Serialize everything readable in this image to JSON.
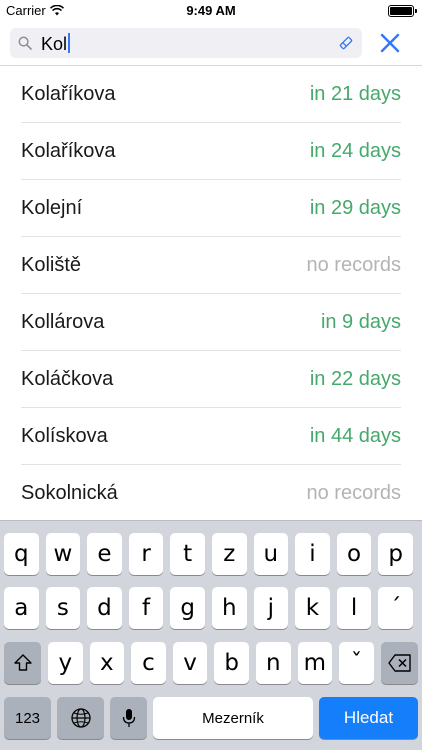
{
  "status_bar": {
    "carrier": "Carrier",
    "time": "9:49 AM",
    "wifi_icon": "wifi-icon",
    "battery_level": 1.0
  },
  "search": {
    "value": "Kol",
    "search_icon": "magnifier-icon",
    "clear_icon": "pencil-eraser-icon",
    "close_icon": "close-x-icon"
  },
  "colors": {
    "accent": "#45a96b",
    "muted": "#b4b4b4",
    "key_blue": "#157efb"
  },
  "results": [
    {
      "name": "Kolaříkova",
      "due": "in 21 days",
      "has_records": true
    },
    {
      "name": "Kolaříkova",
      "due": "in 24 days",
      "has_records": true
    },
    {
      "name": "Kolejní",
      "due": "in 29 days",
      "has_records": true
    },
    {
      "name": "Koliště",
      "due": "no records",
      "has_records": false
    },
    {
      "name": "Kollárova",
      "due": "in 9 days",
      "has_records": true
    },
    {
      "name": "Koláčkova",
      "due": "in 22 days",
      "has_records": true
    },
    {
      "name": "Kolískova",
      "due": "in 44 days",
      "has_records": true
    },
    {
      "name": "Sokolnická",
      "due": "no records",
      "has_records": false
    }
  ],
  "keyboard": {
    "row1": [
      "q",
      "w",
      "e",
      "r",
      "t",
      "z",
      "u",
      "i",
      "o",
      "p"
    ],
    "row2": [
      "a",
      "s",
      "d",
      "f",
      "g",
      "h",
      "j",
      "k",
      "l",
      "´"
    ],
    "row3": [
      "y",
      "x",
      "c",
      "v",
      "b",
      "n",
      "m",
      "ˇ"
    ],
    "numbers_label": "123",
    "space_label": "Mezerník",
    "search_label": "Hledat",
    "shift_icon": "shift-icon",
    "globe_icon": "globe-icon",
    "mic_icon": "microphone-icon",
    "backspace_icon": "backspace-icon"
  }
}
